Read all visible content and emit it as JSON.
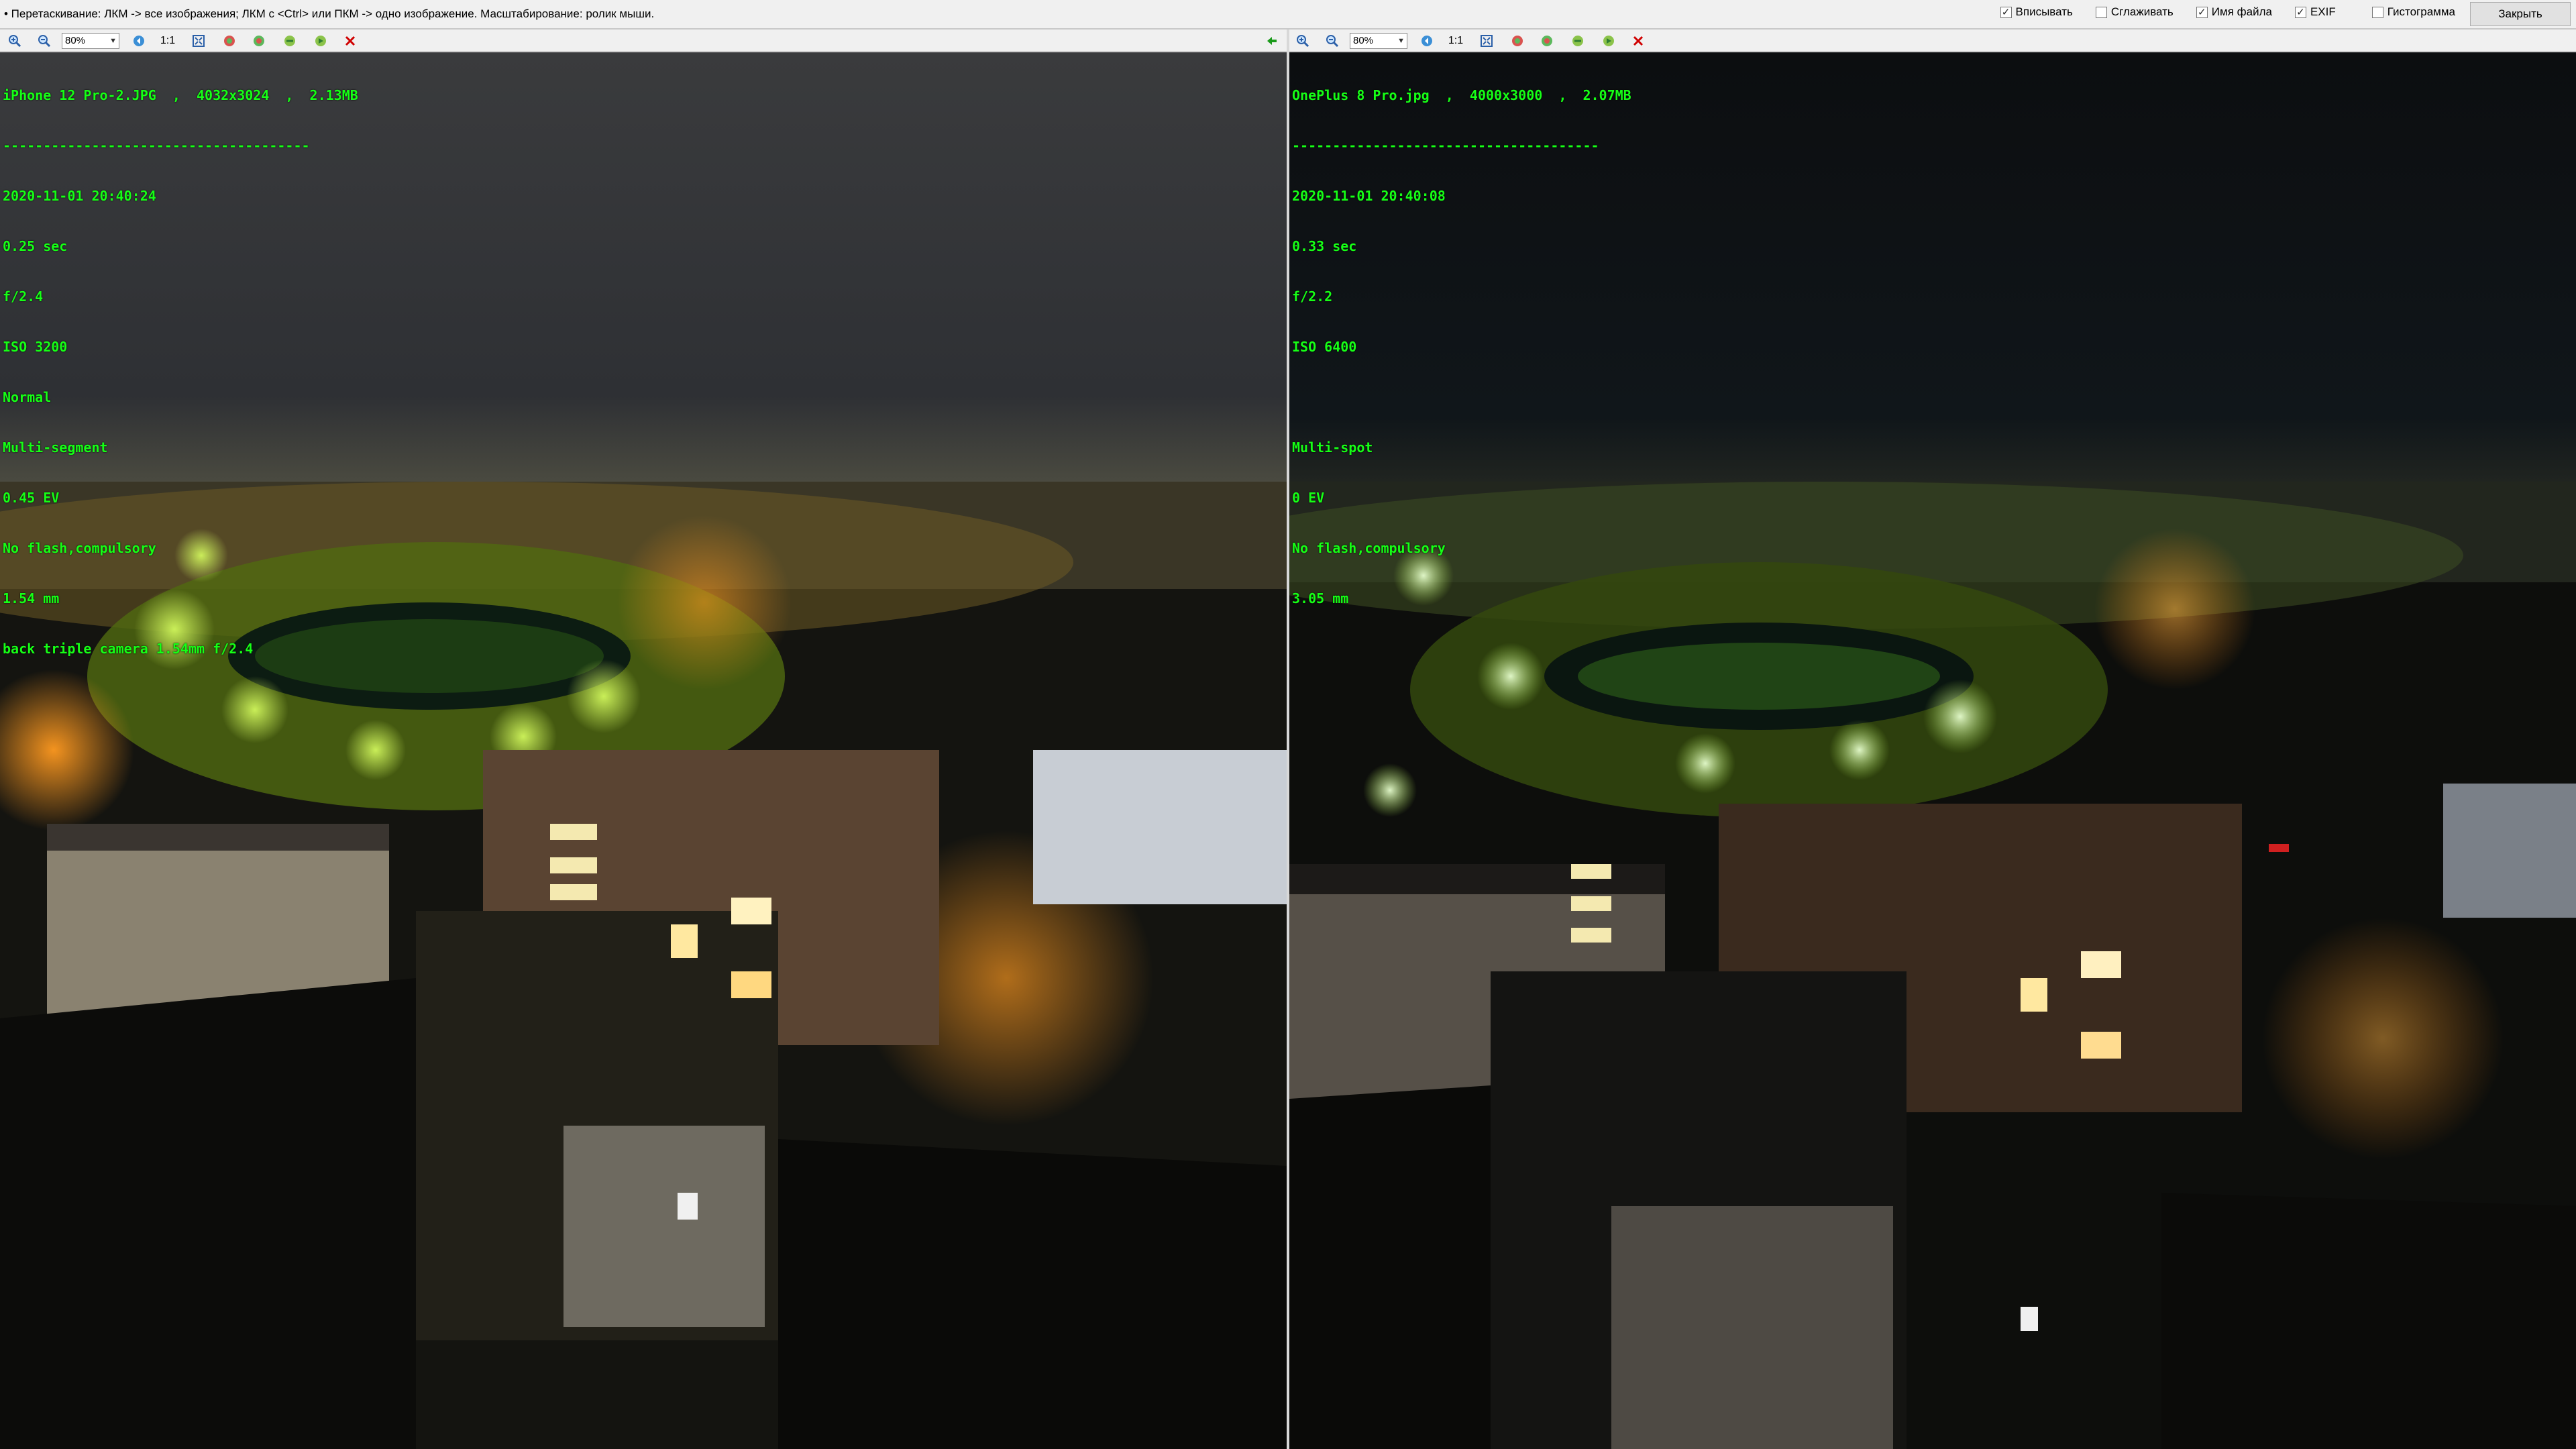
{
  "hint": "• Перетаскивание: ЛКМ -> все изображения; ЛКМ с <Ctrl> или ПКМ -> одно изображение. Масштабирование: ролик мыши.",
  "options": [
    {
      "label": "Вписывать",
      "checked": true
    },
    {
      "label": "Сглаживать",
      "checked": false
    },
    {
      "label": "Имя файла",
      "checked": true
    },
    {
      "label": "EXIF",
      "checked": true
    },
    {
      "label": "Гистограмма",
      "checked": false
    }
  ],
  "close_label": "Закрыть",
  "toolbar": {
    "zoom_left": "80%",
    "zoom_right": "80%",
    "one_to_one": "1:1"
  },
  "left": {
    "header": "iPhone 12 Pro-2.JPG  ,  4032x3024  ,  2.13MB",
    "separator": "--------------------------------------",
    "datetime": "2020-11-01 20:40:24",
    "exposure": "0.25 sec",
    "aperture": "f/2.4",
    "iso": "ISO 3200",
    "mode": "Normal",
    "metering": "Multi-segment",
    "ev": "0.45 EV",
    "flash": "No flash,compulsory",
    "focal": "1.54 mm",
    "lens": "back triple camera 1.54mm f/2.4"
  },
  "right": {
    "header": "OnePlus 8 Pro.jpg  ,  4000x3000  ,  2.07MB",
    "separator": "--------------------------------------",
    "datetime": "2020-11-01 20:40:08",
    "exposure": "0.33 sec",
    "aperture": "f/2.2",
    "iso": "ISO 6400",
    "mode": "",
    "metering": "Multi-spot",
    "ev": "0 EV",
    "flash": "No flash,compulsory",
    "focal": "3.05 mm"
  },
  "colors": {
    "exif_text": "#16ff16",
    "close_icon": "#d00000",
    "arrow_icon": "#1a9a1a"
  },
  "icons": [
    "zoom-in-icon",
    "zoom-out-icon",
    "prev-icon",
    "fit-icon",
    "rotate-icon",
    "flip-icon",
    "save-icon",
    "next-icon",
    "close-icon",
    "back-arrow-icon"
  ]
}
